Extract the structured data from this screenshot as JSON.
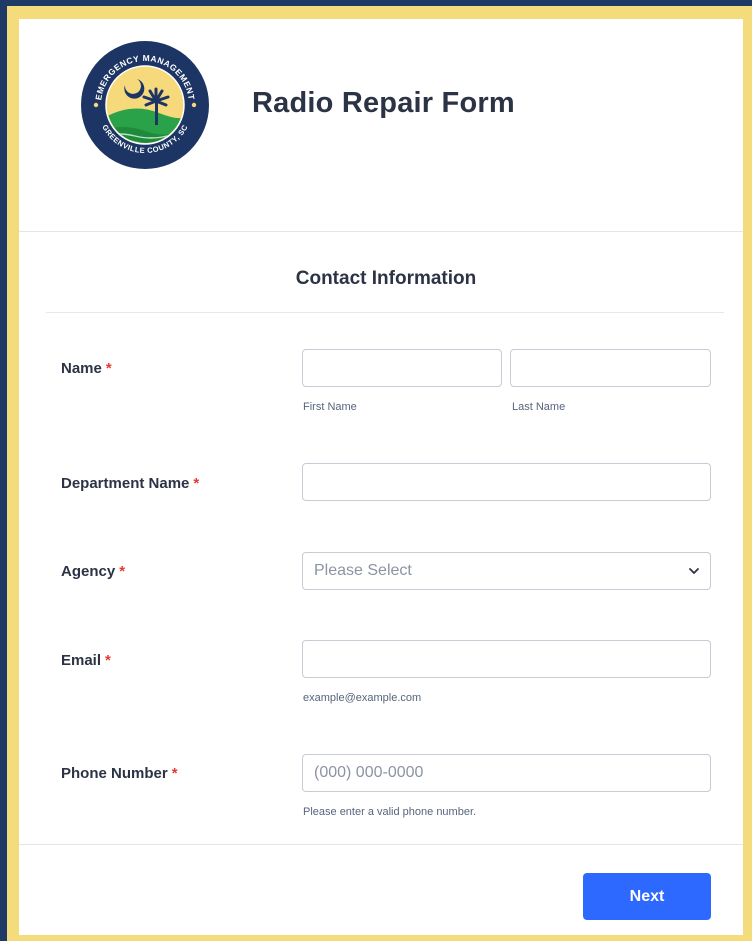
{
  "header": {
    "logo_text_top": "EMERGENCY MANAGEMENT",
    "logo_text_bottom": "GREENVILLE COUNTY, SC",
    "title": "Radio Repair Form"
  },
  "section": {
    "title": "Contact Information"
  },
  "fields": {
    "name": {
      "label": "Name",
      "required": "*",
      "first_sublabel": "First Name",
      "last_sublabel": "Last Name"
    },
    "department": {
      "label": "Department Name",
      "required": "*"
    },
    "agency": {
      "label": "Agency",
      "required": "*",
      "selected": "Please Select"
    },
    "email": {
      "label": "Email",
      "required": "*",
      "sublabel": "example@example.com"
    },
    "phone": {
      "label": "Phone Number",
      "required": "*",
      "placeholder": "(000) 000-0000",
      "sublabel": "Please enter a valid phone number."
    }
  },
  "footer": {
    "next_label": "Next"
  },
  "colors": {
    "outer_background": "#1f3a66",
    "frame": "#f4dc7c",
    "primary_button": "#2e69ff",
    "required": "#e53935",
    "title_text": "#2c3345"
  }
}
